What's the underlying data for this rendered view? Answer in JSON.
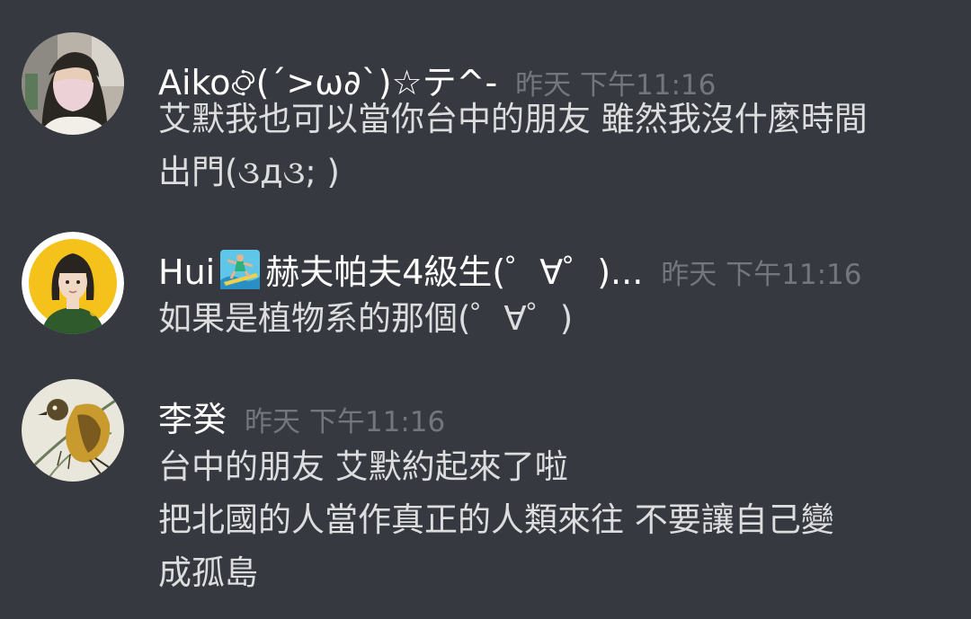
{
  "messages": [
    {
      "username": "Aiko࿂(´>ω∂`)☆テ^-",
      "timestamp": "昨天 下午11:16",
      "lines": [
        "艾默我也可以當你台中的朋友 雖然我沒什麼時間",
        "出門(૩д૩; )"
      ]
    },
    {
      "username_prefix": "Hui",
      "username_emoji": "surfer-emoji",
      "username_suffix": "赫夫帕夫4級生(゜∀゜)...",
      "timestamp": "昨天 下午11:16",
      "lines": [
        "如果是植物系的那個(゜∀゜)"
      ]
    },
    {
      "username": "李癸",
      "timestamp": "昨天 下午11:16",
      "lines": [
        "台中的朋友  艾默約起來了啦",
        "把北國的人當作真正的人類來往 不要讓自己變",
        "成孤島"
      ]
    }
  ],
  "colors": {
    "background": "#36393f",
    "username": "#ffffff",
    "timestamp": "#72767d",
    "message_text": "#dcddde"
  }
}
